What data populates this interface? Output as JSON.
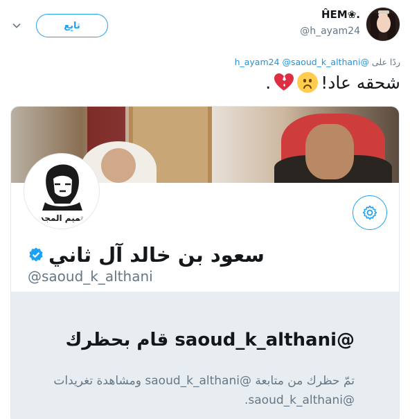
{
  "tweet": {
    "display_name": "ĤEM❀.",
    "handle": "@h_ayam24",
    "follow_label": "تابِع",
    "reply_prefix": "ردًا على",
    "reply_mentions": "@h_ayam24 @saoud_k_althani",
    "text": "شحقه عاد!",
    "text_end": "."
  },
  "card": {
    "name": "سعود بن خالد آل ثاني",
    "handle": "@saoud_k_althani",
    "blocked_title": "@saoud_k_althani قام بحظرك",
    "blocked_desc": "تمّ حظرك من متابعة @saoud_k_althani ومشاهدة تغريدات @saoud_k_althani.",
    "avatar_caption": "تميم المجد"
  },
  "icons": {
    "chevron": "chevron-down-icon",
    "gear": "gear-icon",
    "verified": "verified-badge-icon",
    "sad": "sad-face-emoji",
    "heart": "broken-heart-emoji"
  },
  "colors": {
    "accent": "#1da1f2",
    "muted": "#657786",
    "panel": "#e8edf1"
  }
}
